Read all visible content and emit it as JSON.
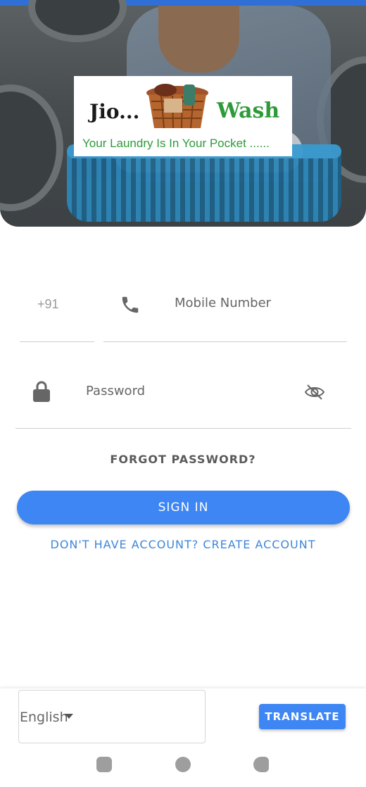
{
  "logo": {
    "brand_left": "Jio...",
    "brand_right": "Wash",
    "tagline": "Your Laundry Is In Your Pocket ......"
  },
  "login": {
    "country_code": "+91",
    "mobile_placeholder": "Mobile Number",
    "password_placeholder": "Password",
    "forgot_label": "FORGOT PASSWORD?",
    "signin_label": "SIGN IN",
    "create_account_label": "DON'T HAVE ACCOUNT? CREATE ACCOUNT"
  },
  "footer": {
    "language_selected": "English",
    "translate_label": "TRANSLATE"
  },
  "colors": {
    "accent": "#3d86f3",
    "brand_green": "#2e9a3a"
  },
  "icons": {
    "phone": "phone-icon",
    "lock": "lock-icon",
    "visibility": "eye-off-icon",
    "dropdown": "caret-down-icon"
  }
}
